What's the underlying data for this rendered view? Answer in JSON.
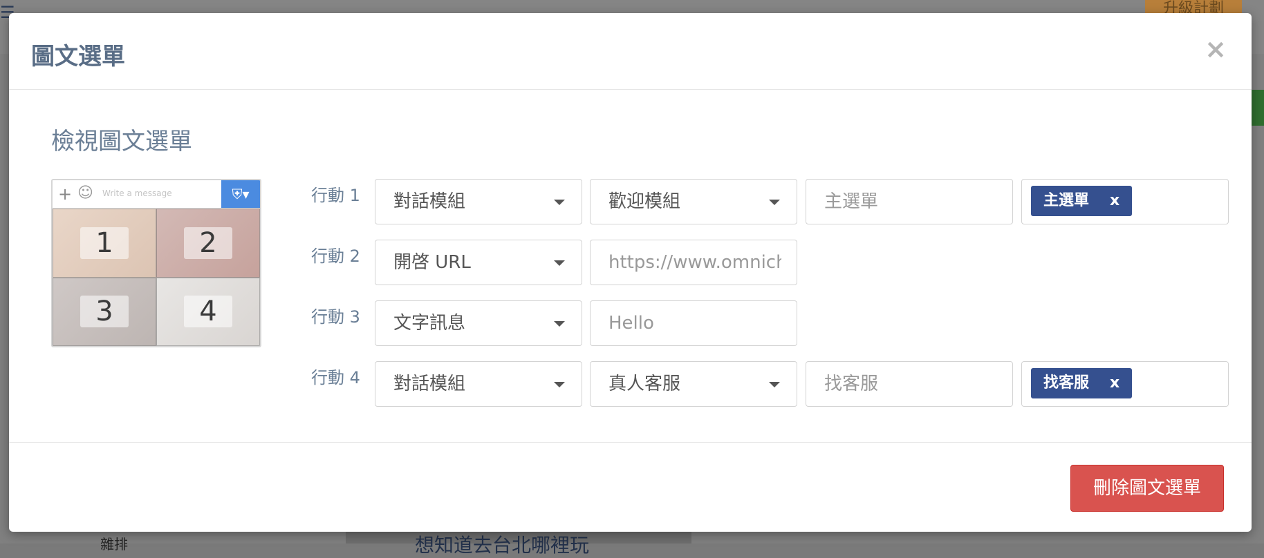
{
  "background": {
    "upgrade_label": "升級計劃",
    "bottom_title": "想知道去台北哪裡玩",
    "bottom_label": "雜排"
  },
  "modal": {
    "title": "圖文選單",
    "close_glyph": "×",
    "section_title": "檢視圖文選單",
    "preview": {
      "message_placeholder": "Write a message",
      "cells": [
        "1",
        "2",
        "3",
        "4"
      ]
    },
    "actions": [
      {
        "label": "行動 1",
        "type": "對話模組",
        "module": "歡迎模組",
        "block_placeholder": "主選單",
        "tag": "主選單"
      },
      {
        "label": "行動 2",
        "type": "開啓 URL",
        "url_value": "https://www.omnichat.ai"
      },
      {
        "label": "行動 3",
        "type": "文字訊息",
        "text_value": "Hello"
      },
      {
        "label": "行動 4",
        "type": "對話模組",
        "module": "真人客服",
        "block_placeholder": "找客服",
        "tag": "找客服"
      }
    ],
    "tag_remove": "x",
    "delete_label": "刪除圖文選單"
  },
  "colors": {
    "title": "#596d86",
    "tag_bg": "#35508f",
    "delete_bg": "#d9534f"
  }
}
